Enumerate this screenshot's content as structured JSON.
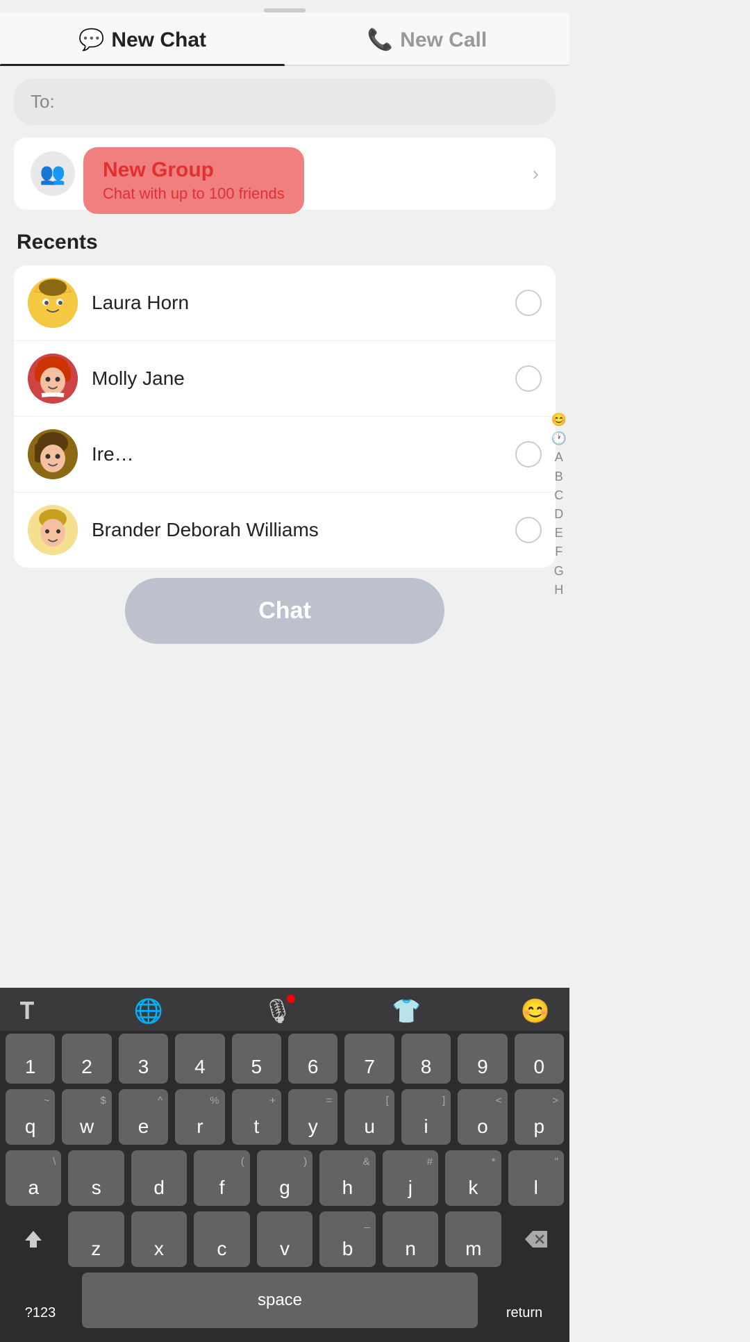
{
  "dragIndicator": true,
  "tabs": [
    {
      "id": "new-chat",
      "label": "New Chat",
      "icon": "💬",
      "active": true
    },
    {
      "id": "new-call",
      "label": "New Call",
      "icon": "📞",
      "active": false
    }
  ],
  "toInput": {
    "placeholder": "To:"
  },
  "newGroup": {
    "title": "New Group",
    "subtitle": "Chat with up to 100 friends",
    "icon": "👥"
  },
  "recentsLabel": "Recents",
  "contacts": [
    {
      "name": "Laura Horn",
      "avatarClass": "avatar-1"
    },
    {
      "name": "Molly Jane",
      "avatarClass": "avatar-2"
    },
    {
      "name": "Ire…",
      "avatarClass": "avatar-3"
    },
    {
      "name": "Brander Deborah Williams",
      "avatarClass": "avatar-4"
    }
  ],
  "alphabetSidebar": [
    "😊",
    "🕐",
    "A",
    "B",
    "C",
    "D",
    "E",
    "F",
    "G",
    "H"
  ],
  "chatOverlay": "Chat",
  "keyboard": {
    "toolbarIcons": [
      "T",
      "🌐",
      "🎙",
      "👕",
      "😊"
    ],
    "numRow": [
      "1",
      "2",
      "3",
      "4",
      "5",
      "6",
      "7",
      "8",
      "9",
      "0"
    ],
    "numRowSubs": [
      "~",
      "$",
      "^",
      "%",
      "+",
      "=",
      "[",
      "]",
      "<",
      ">"
    ],
    "row1": [
      "q",
      "w",
      "e",
      "r",
      "t",
      "y",
      "u",
      "i",
      "o",
      "p"
    ],
    "row1subs": [
      "",
      "",
      "",
      "",
      "",
      "",
      "",
      "",
      "",
      ""
    ],
    "row2": [
      "a",
      "s",
      "d",
      "f",
      "g",
      "h",
      "j",
      "k",
      "l"
    ],
    "row2subs": [
      "\\",
      "",
      "",
      "(",
      ")",
      "&",
      "#",
      "*",
      "\""
    ],
    "row3": [
      "z",
      "x",
      "c",
      "v",
      "b",
      "n",
      "m"
    ],
    "row3subs": [
      "",
      "",
      "",
      "",
      "_",
      "",
      ""
    ]
  },
  "colors": {
    "activeTabUnderline": "#222222",
    "newGroupHighlight": "#f08080",
    "newGroupText": "#e03030",
    "chatOverlayBg": "rgba(180,185,200,0.85)"
  }
}
